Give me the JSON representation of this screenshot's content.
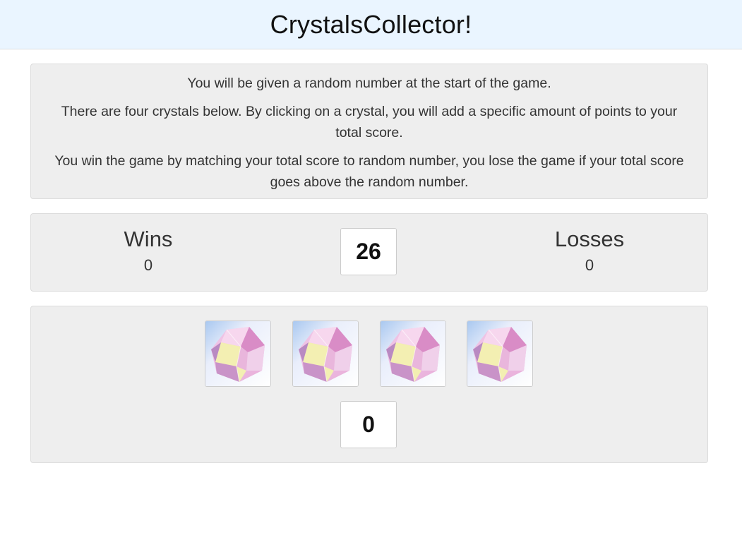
{
  "header": {
    "title": "CrystalsCollector!"
  },
  "instructions": {
    "line1": "You will be given a random number at the start of the game.",
    "line2": "There are four crystals below. By clicking on a crystal, you will add a specific amount of points to your total score.",
    "line3": "You win the game by matching your total score to random number, you lose the game if your total score goes above the random number."
  },
  "scoreboard": {
    "wins_label": "Wins",
    "wins_value": "0",
    "target_number": "26",
    "losses_label": "Losses",
    "losses_value": "0"
  },
  "crystals": {
    "items": [
      {
        "icon": "crystal-icon"
      },
      {
        "icon": "crystal-icon"
      },
      {
        "icon": "crystal-icon"
      },
      {
        "icon": "crystal-icon"
      }
    ],
    "total_score": "0"
  },
  "colors": {
    "header_bg": "#eaf5ff",
    "well_bg": "#eeeeee",
    "crystal_pink": "#e6a6d6",
    "crystal_yellow": "#f3efb2"
  }
}
